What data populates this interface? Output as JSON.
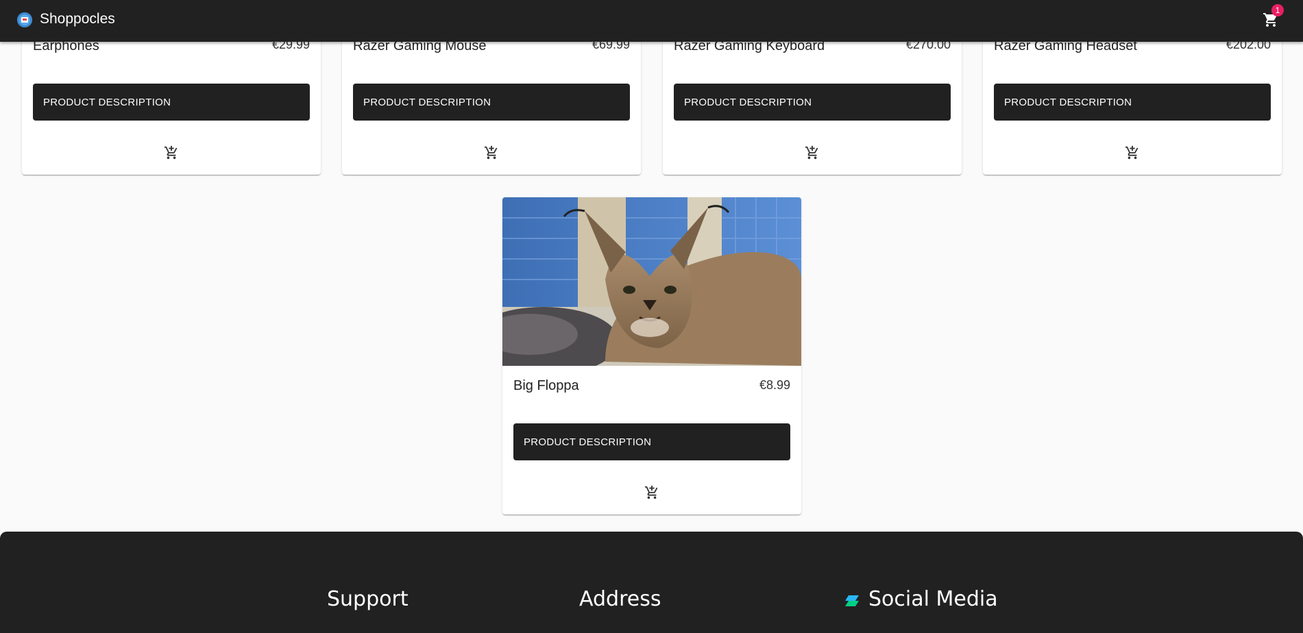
{
  "app": {
    "brand": "Shoppocles",
    "cart_count": "1"
  },
  "colors": {
    "appbar": "#212121",
    "badge": "#e91e63",
    "button": "#212121",
    "background": "#fafafa"
  },
  "icons": {
    "logo": "shop-logo-icon",
    "cart": "shopping-cart-icon",
    "add_to_cart": "add-shopping-cart-icon",
    "social": "social-media-icon"
  },
  "products": [
    {
      "name": "Earphones",
      "price": "€29.99",
      "button": "PRODUCT DESCRIPTION"
    },
    {
      "name": "Razer Gaming Mouse",
      "price": "€69.99",
      "button": "PRODUCT DESCRIPTION"
    },
    {
      "name": "Razer Gaming Keyboard",
      "price": "€270.00",
      "button": "PRODUCT DESCRIPTION"
    },
    {
      "name": "Razer Gaming Headset",
      "price": "€202.00",
      "button": "PRODUCT DESCRIPTION"
    },
    {
      "name": "Big Floppa",
      "price": "€8.99",
      "button": "PRODUCT DESCRIPTION"
    }
  ],
  "footer": {
    "support": "Support",
    "address": "Address",
    "social": "Social Media"
  }
}
